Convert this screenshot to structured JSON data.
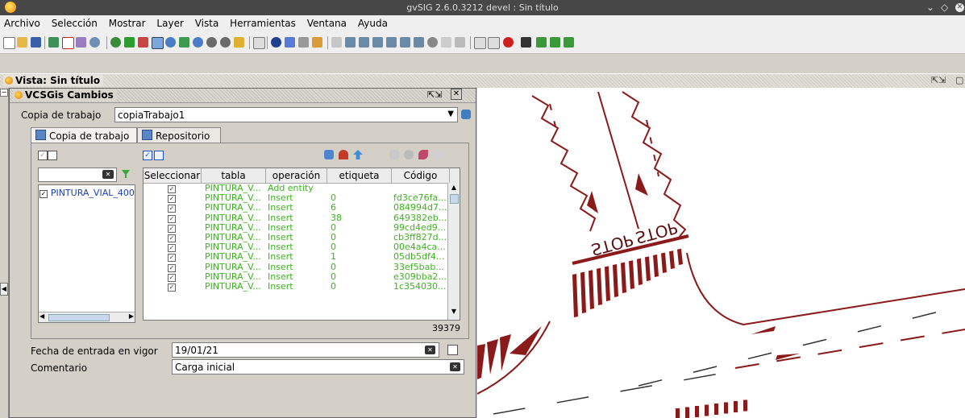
{
  "window": {
    "title": "gvSIG 2.6.0.3212 devel : Sin título",
    "controls": [
      "chevron-down-icon",
      "diamond-icon",
      "close-icon"
    ]
  },
  "menu": {
    "items": [
      "Archivo",
      "Selección",
      "Mostrar",
      "Layer",
      "Vista",
      "Herramientas",
      "Ventana",
      "Ayuda"
    ]
  },
  "view": {
    "title": "Vista: Sin título"
  },
  "panel": {
    "title": "VCSGis Cambios",
    "working_copy_label": "Copia de trabajo",
    "working_copy_value": "copiaTrabajo1",
    "tabs": [
      "Copia de trabajo",
      "Repositorio"
    ],
    "layer_item": "PINTURA_VIAL_400",
    "columns": [
      "Seleccionar",
      "tabla",
      "operación",
      "etiqueta",
      "Código"
    ],
    "rows": [
      {
        "tabla": "PINTURA_V...",
        "operacion": "Add entity",
        "etiqueta": "",
        "codigo": ""
      },
      {
        "tabla": "PINTURA_V...",
        "operacion": "Insert",
        "etiqueta": "0",
        "codigo": "fd3ce76fa..."
      },
      {
        "tabla": "PINTURA_V...",
        "operacion": "Insert",
        "etiqueta": "6",
        "codigo": "084994d7..."
      },
      {
        "tabla": "PINTURA_V...",
        "operacion": "Insert",
        "etiqueta": "38",
        "codigo": "649382eb..."
      },
      {
        "tabla": "PINTURA_V...",
        "operacion": "Insert",
        "etiqueta": "0",
        "codigo": "99cd4ed9..."
      },
      {
        "tabla": "PINTURA_V...",
        "operacion": "Insert",
        "etiqueta": "0",
        "codigo": "cb3ff827d..."
      },
      {
        "tabla": "PINTURA_V...",
        "operacion": "Insert",
        "etiqueta": "0",
        "codigo": "00e4a4ca..."
      },
      {
        "tabla": "PINTURA_V...",
        "operacion": "Insert",
        "etiqueta": "1",
        "codigo": "05db5df4..."
      },
      {
        "tabla": "PINTURA_V...",
        "operacion": "Insert",
        "etiqueta": "0",
        "codigo": "33ef5bab..."
      },
      {
        "tabla": "PINTURA_V...",
        "operacion": "Insert",
        "etiqueta": "0",
        "codigo": "e309bba2..."
      },
      {
        "tabla": "PINTURA_V...",
        "operacion": "Insert",
        "etiqueta": "0",
        "codigo": "1c354030..."
      }
    ],
    "count": "39379",
    "fecha_label": "Fecha de entrada en vigor",
    "fecha_value": "19/01/21",
    "comentario_label": "Comentario",
    "comentario_value": "Carga inicial"
  },
  "map": {
    "stop_text": "STOP",
    "road_color": "#8b1a1a"
  }
}
